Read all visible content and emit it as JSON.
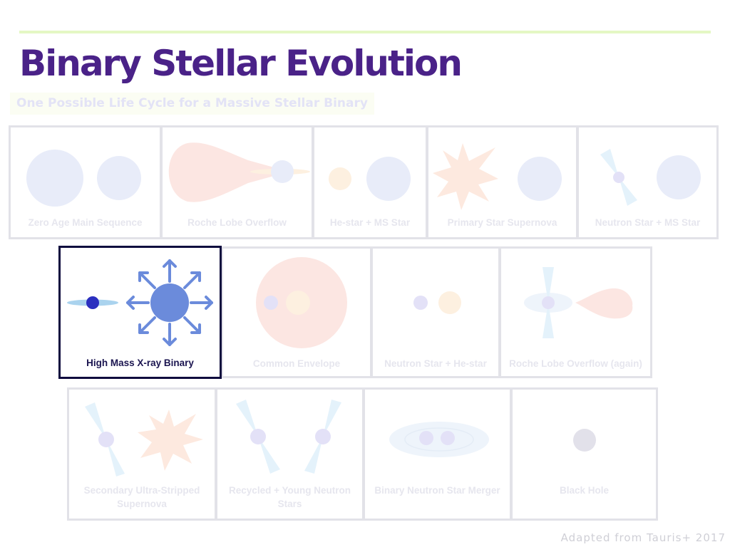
{
  "title": "Binary Stellar Evolution",
  "subtitle": "One Possible Life Cycle for a Massive Stellar Binary",
  "stages": [
    "Zero Age Main Sequence",
    "Roche Lobe Overflow",
    "He-star + MS Star",
    "Primary Star Supernova",
    "Neutron Star + MS Star",
    "High Mass X-ray Binary",
    "Common Envelope",
    "Neutron Star + He-star",
    "Roche Lobe Overflow (again)",
    "Secondary Ultra-Stripped Supernova",
    "Recycled + Young Neutron Stars",
    "Binary Neutron Star Merger",
    "Black Hole"
  ],
  "highlighted_stage": "High Mass X-ray Binary",
  "credit": "Adapted from Tauris+ 2017",
  "colors": {
    "title": "#4a2288",
    "highlight_border": "#0f0c3e",
    "star_highlight": "#6b8bdb",
    "faded_blue": "#e8ecf9",
    "faded_red": "#fce6e2",
    "faded_orange": "#fdf0e0",
    "faded_lavender": "#e3e1f7"
  }
}
